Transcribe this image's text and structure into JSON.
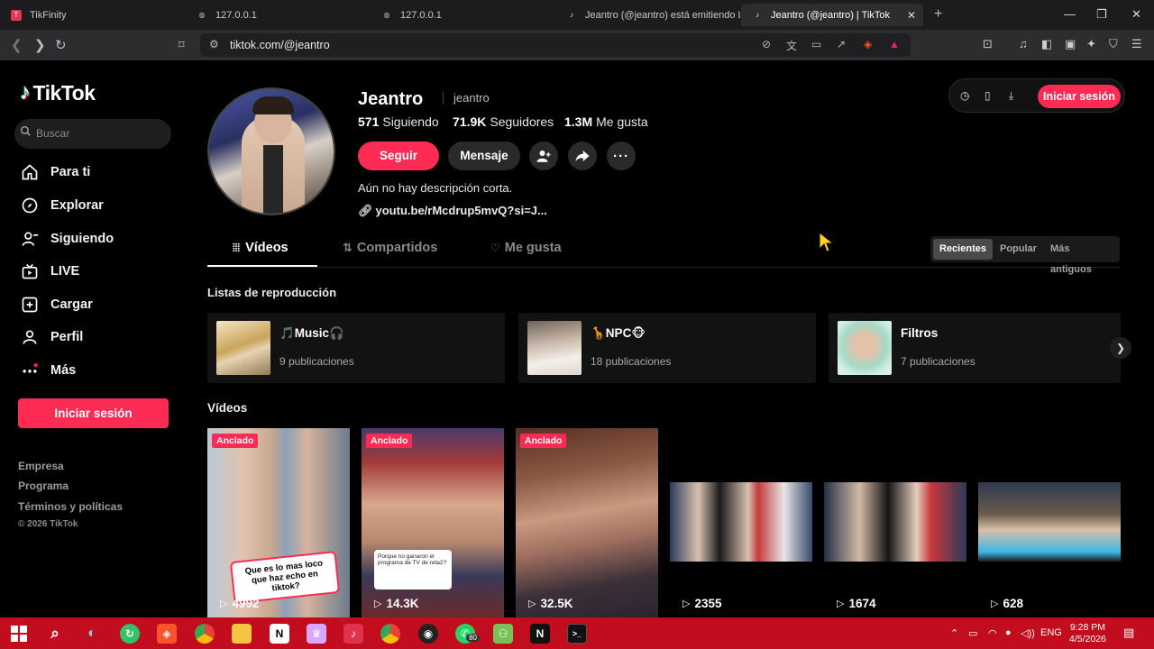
{
  "browser": {
    "tabs": [
      {
        "title": "TikFinity",
        "active": false
      },
      {
        "title": "127.0.0.1",
        "active": false
      },
      {
        "title": "127.0.0.1",
        "active": false
      },
      {
        "title": "Jeantro (@jeantro) está emitiendo LI",
        "active": false
      },
      {
        "title": "Jeantro (@jeantro) | TikTok",
        "active": true
      }
    ],
    "url": "tiktok.com/@jeantro",
    "new_tab": "+"
  },
  "sidebar": {
    "logo": "TikTok",
    "search_placeholder": "Buscar",
    "nav": [
      {
        "label": "Para ti",
        "icon": "home-icon"
      },
      {
        "label": "Explorar",
        "icon": "compass-icon"
      },
      {
        "label": "Siguiendo",
        "icon": "following-icon"
      },
      {
        "label": "LIVE",
        "icon": "live-icon"
      },
      {
        "label": "Cargar",
        "icon": "upload-icon"
      },
      {
        "label": "Perfil",
        "icon": "profile-icon"
      },
      {
        "label": "Más",
        "icon": "more-icon"
      }
    ],
    "login": "Iniciar sesión",
    "footer": [
      "Empresa",
      "Programa",
      "Términos y políticas"
    ],
    "copyright": "© 2026 TikTok"
  },
  "profile": {
    "name": "Jeantro",
    "handle": "jeantro",
    "following_count": "571",
    "following_label": "Siguiendo",
    "followers_count": "71.9K",
    "followers_label": "Seguidores",
    "likes_count": "1.3M",
    "likes_label": "Me gusta",
    "follow_btn": "Seguir",
    "message_btn": "Mensaje",
    "bio": "Aún no hay descripción corta.",
    "link": "youtu.be/rMcdrup5mvQ?si=J..."
  },
  "top_login": "Iniciar sesión",
  "tabs": [
    {
      "label": "Vídeos",
      "active": true
    },
    {
      "label": "Compartidos",
      "active": false
    },
    {
      "label": "Me gusta",
      "active": false
    }
  ],
  "sort": [
    {
      "label": "Recientes",
      "active": true
    },
    {
      "label": "Popular",
      "active": false
    },
    {
      "label": "Más antiguos",
      "active": false
    }
  ],
  "playlists_title": "Listas de reproducción",
  "playlists": [
    {
      "name": "🎵Music🎧",
      "count": "9 publicaciones"
    },
    {
      "name": "🦒NPC🐵",
      "count": "18 publicaciones"
    },
    {
      "name": "Filtros",
      "count": "7 publicaciones"
    }
  ],
  "videos_title": "Vídeos",
  "videos": [
    {
      "pinned": "Anclado",
      "views": "4992",
      "caption": "Que es lo mas loco que haz echo en tiktok?"
    },
    {
      "pinned": "Anclado",
      "views": "14.3K",
      "reply": "Porque no ganaron el programa de TV de reta2?"
    },
    {
      "pinned": "Anclado",
      "views": "32.5K"
    },
    {
      "pinned": "",
      "views": "2355"
    },
    {
      "pinned": "",
      "views": "1674"
    },
    {
      "pinned": "",
      "views": "628"
    }
  ],
  "taskbar": {
    "lang": "ENG",
    "time": "9:28 PM",
    "date": "4/5/2026",
    "whatsapp_badge": "80"
  },
  "colors": {
    "accent": "#fe2c55",
    "taskbar": "#c20d1f",
    "background": "#000000"
  }
}
